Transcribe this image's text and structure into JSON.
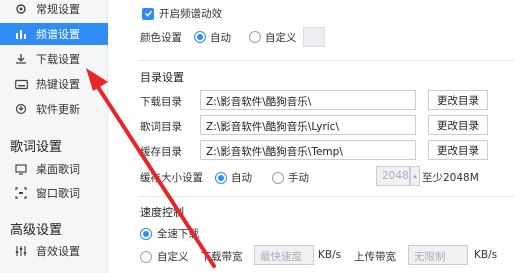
{
  "sidebar": {
    "items_top": [
      {
        "label": "常规设置",
        "icon": "gear-icon"
      },
      {
        "label": "频谱设置",
        "icon": "spectrum-icon",
        "active": true
      },
      {
        "label": "下载设置",
        "icon": "download-icon"
      },
      {
        "label": "热键设置",
        "icon": "keyboard-icon"
      },
      {
        "label": "软件更新",
        "icon": "update-icon"
      }
    ],
    "section_lyrics": "歌词设置",
    "items_lyrics": [
      {
        "label": "桌面歌词",
        "icon": "desktop-lyrics-icon"
      },
      {
        "label": "窗口歌词",
        "icon": "window-lyrics-icon"
      }
    ],
    "section_advanced": "高级设置",
    "items_advanced": [
      {
        "label": "音效设置",
        "icon": "equalizer-icon"
      }
    ]
  },
  "spectrum": {
    "enable_label": "开启频谱动效",
    "color_label": "颜色设置",
    "auto": "自动",
    "custom": "自定义"
  },
  "directory": {
    "title": "目录设置",
    "download_label": "下载目录",
    "download_path": "Z:\\影音软件\\酷狗音乐\\",
    "lyric_label": "歌词目录",
    "lyric_path": "Z:\\影音软件\\酷狗音乐\\Lyric\\",
    "cache_label": "缓存目录",
    "cache_path": "Z:\\影音软件\\酷狗音乐\\Temp\\",
    "change_btn": "更改目录",
    "cache_size_label": "缓存大小设置",
    "auto": "自动",
    "manual": "手动",
    "cache_size_value": "2048",
    "cache_size_hint": "至少2048M"
  },
  "speed": {
    "title": "速度控制",
    "full_speed": "全速下载",
    "custom": "自定义",
    "download_bw_label": "下载带宽",
    "download_bw_placeholder": "最快速度",
    "kbs1": "KB/s",
    "upload_bw_label": "上传带宽",
    "upload_bw_placeholder": "无限制",
    "kbs2": "KB/s"
  },
  "colors": {
    "accent": "#2f8cf5",
    "arrow": "#e8262a"
  }
}
